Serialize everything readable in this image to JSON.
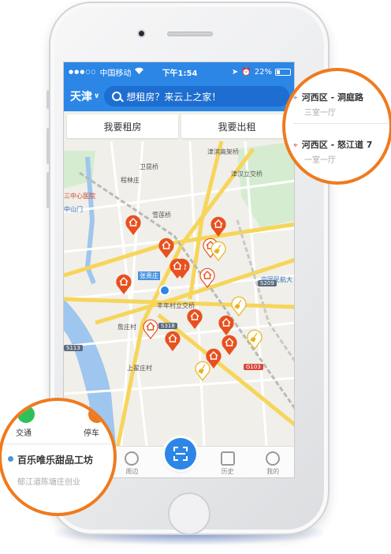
{
  "status_bar": {
    "carrier": "中国移动",
    "time": "下午1:54",
    "battery": "22%"
  },
  "nav": {
    "city": "天津",
    "search_placeholder": "想租房？来云上之家！"
  },
  "tabs": [
    {
      "label": "我要租房"
    },
    {
      "label": "我要出租"
    }
  ],
  "map_labels": {
    "l1": "卫昆桥",
    "l2": "程林庄",
    "l3": "三中心医院",
    "l4": "中山门",
    "l5": "雪莲桥",
    "l6": "张贵庄",
    "l7": "丰年村立交桥",
    "l8": "津汉立交桥",
    "l9": "津滨高架桥",
    "l10": "中国民航大",
    "l11": "上翟庄村",
    "l12": "詹庄村",
    "s1": "S209",
    "s2": "S113",
    "s3": "G103",
    "s4": "S318"
  },
  "bottom_bar": [
    {
      "label": "周边",
      "icon": "surroundings-icon"
    },
    {
      "label": "历史",
      "icon": "history-icon"
    },
    {
      "label": "我的",
      "icon": "profile-icon"
    }
  ],
  "callout_right": [
    {
      "title": "河西区 - 洞庭路",
      "sub": "三室一厅"
    },
    {
      "title": "河西区 - 怒江道 7",
      "sub": "一室一厅"
    }
  ],
  "callout_left": {
    "cat1": "交通",
    "cat2": "停车",
    "title": "百乐唯乐甜品工坊",
    "sub": "郁江道陈塘庄创业"
  },
  "colors": {
    "brand_blue": "#2b86e6",
    "pin_orange": "#e8501f",
    "callout_orange": "#f07a1e",
    "green_cat": "#2fbf5b"
  }
}
